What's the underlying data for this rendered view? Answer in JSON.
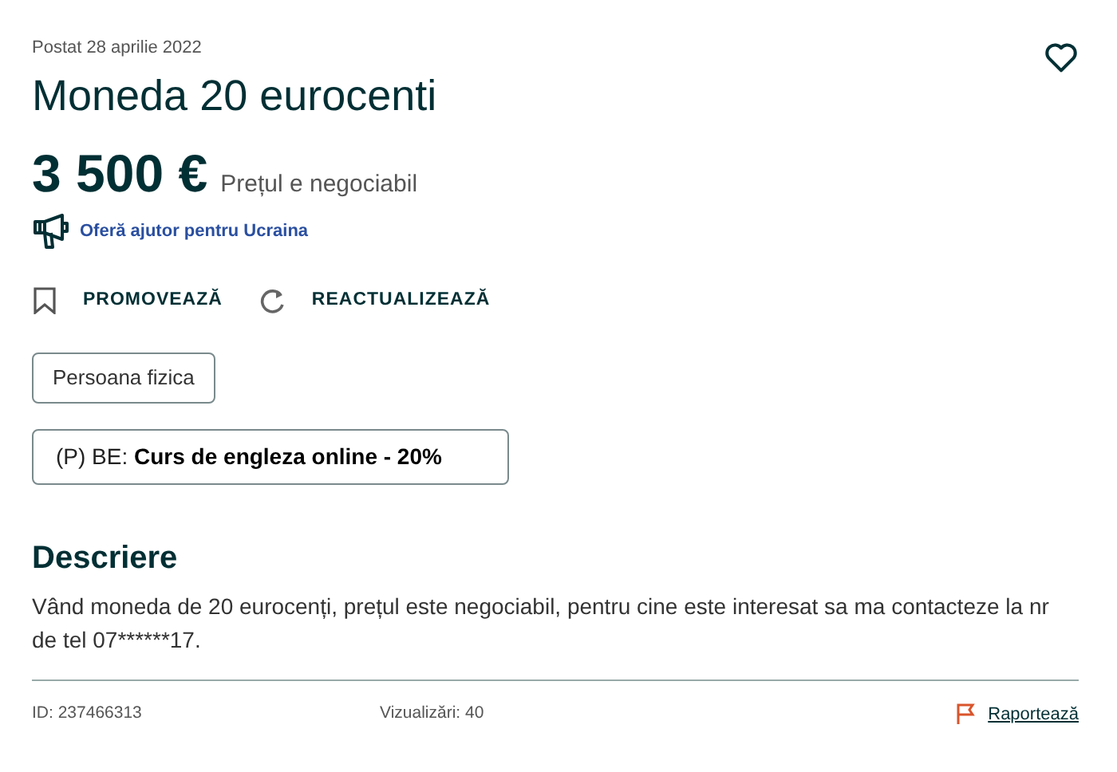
{
  "posted": "Postat 28 aprilie 2022",
  "title": "Moneda 20 eurocenti",
  "price": "3 500 €",
  "price_note": "Prețul e negociabil",
  "ukraine_link": "Oferă ajutor pentru Ucraina",
  "actions": [
    {
      "kind": "bookmark",
      "label": "PROMOVEAZĂ"
    },
    {
      "kind": "refresh",
      "label": "REACTUALIZEAZĂ"
    }
  ],
  "seller_type": "Persoana fizica",
  "promo": "(P) BE: **Curs de engleza online - 20%**",
  "description_heading": "Descriere",
  "description": "Vând moneda de 20 eurocenți, prețul este negociabil, pentru cine este interesat sa ma contacteze la nr de tel 07******17.",
  "footer": {
    "id": "ID: 237466313",
    "views": "Vizualizări: 40",
    "report": "Raportează"
  }
}
